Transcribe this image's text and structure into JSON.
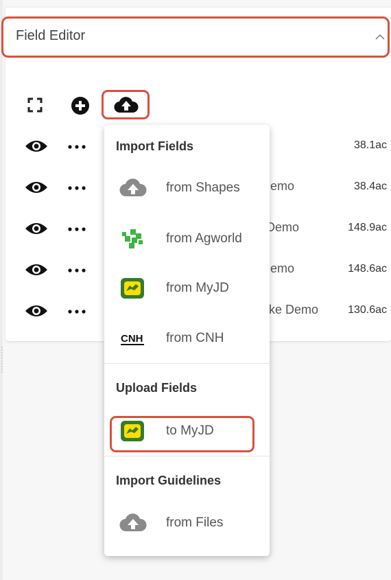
{
  "header": {
    "title": "Field Editor"
  },
  "colors": {
    "highlight": "#d9503e",
    "jd_green": "#367c2b",
    "jd_yellow": "#ffde00",
    "agworld_green": "#3db543"
  },
  "toolbar": {
    "expand_icon": "expand-icon",
    "add_icon": "add-circle-icon",
    "upload_icon": "cloud-upload-icon"
  },
  "rows": [
    {
      "name": "",
      "area": "38.1ac"
    },
    {
      "name": "emo",
      "area": "38.4ac"
    },
    {
      "name": "Demo",
      "area": "148.9ac"
    },
    {
      "name": "emo",
      "area": "148.6ac"
    },
    {
      "name": "ke Demo",
      "area": "130.6ac"
    }
  ],
  "menu": {
    "import_fields": {
      "heading": "Import Fields",
      "items": [
        {
          "label": "from Shapes",
          "icon": "cloud-upload-icon"
        },
        {
          "label": "from Agworld",
          "icon": "agworld-logo-icon"
        },
        {
          "label": "from MyJD",
          "icon": "john-deere-logo-icon"
        },
        {
          "label": "from CNH",
          "icon": "cnh-logo-icon"
        }
      ]
    },
    "upload_fields": {
      "heading": "Upload Fields",
      "items": [
        {
          "label": "to MyJD",
          "icon": "john-deere-logo-icon"
        }
      ]
    },
    "import_guidelines": {
      "heading": "Import Guidelines",
      "items": [
        {
          "label": "from Files",
          "icon": "cloud-upload-icon"
        }
      ]
    }
  }
}
